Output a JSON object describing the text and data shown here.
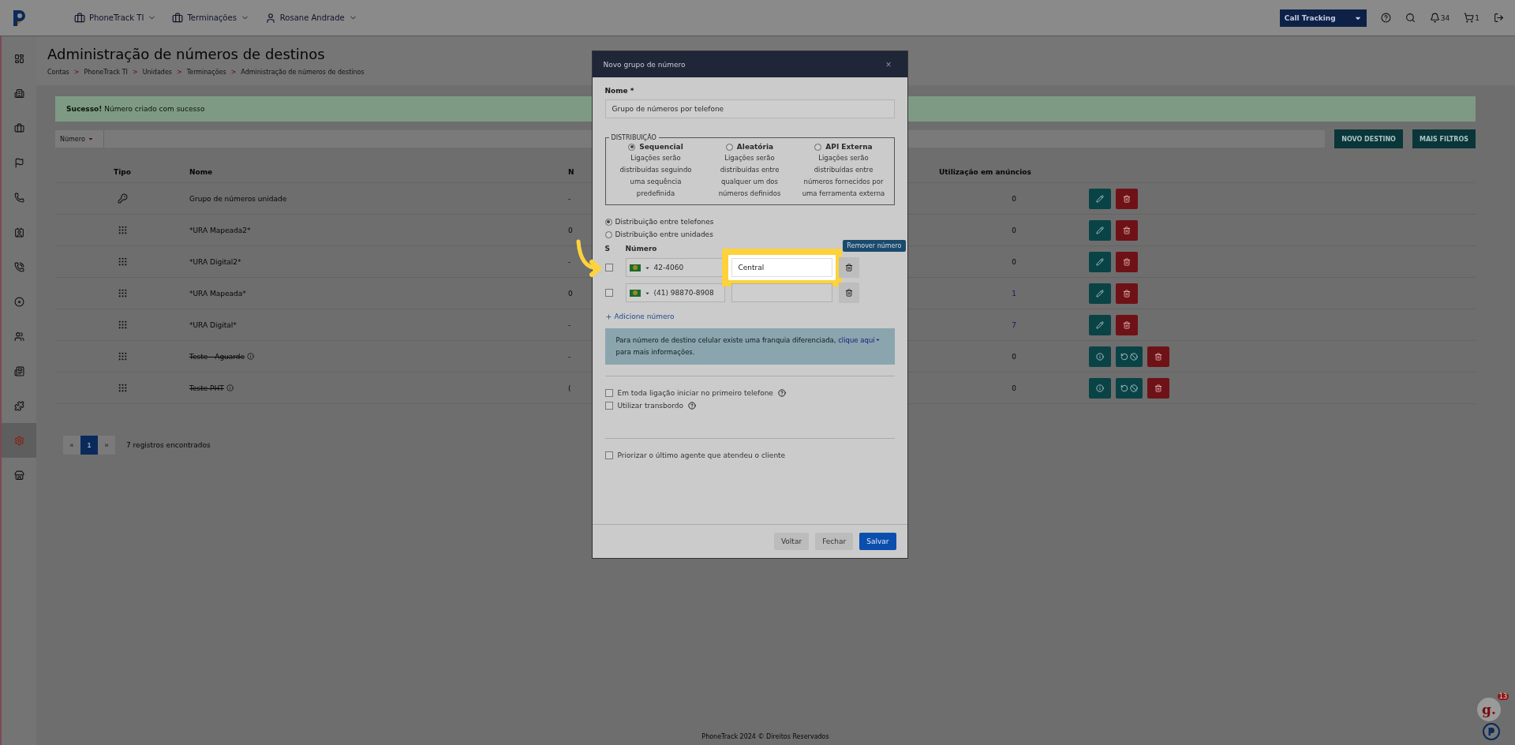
{
  "topbar": {
    "nav": [
      {
        "label": "PhoneTrack TI",
        "kind": "case"
      },
      {
        "label": "Terminações",
        "kind": "case"
      },
      {
        "label": "Rosane Andrade",
        "kind": "user"
      }
    ],
    "product_select": "Call Tracking",
    "notifications": "34",
    "cart": "1"
  },
  "sidebar": {
    "items": [
      {
        "selected": false
      },
      {
        "selected": false
      },
      {
        "selected": false
      },
      {
        "selected": false
      },
      {
        "selected": false
      },
      {
        "selected": false
      },
      {
        "selected": false
      },
      {
        "selected": false
      },
      {
        "selected": false
      },
      {
        "selected": false
      },
      {
        "selected": false
      },
      {
        "selected": true
      },
      {
        "selected": false
      }
    ]
  },
  "page": {
    "title": "Administração de números de destinos",
    "breadcrumb_separator": ">",
    "breadcrumb": [
      "Contas",
      "PhoneTrack TI",
      "Unidades",
      "Terminações",
      "Administração de números de destinos"
    ]
  },
  "alert": {
    "text": "**Sucesso!** Número criado com sucesso"
  },
  "filter": {
    "label": "Número"
  },
  "toolbar_buttons": [
    "NOVO DESTINO",
    "MAIS FILTROS"
  ],
  "table": {
    "columns": [
      "Tipo",
      "Nome",
      "N",
      "Utilização em anúncios"
    ],
    "rows": [
      {
        "kind": "group",
        "name": "Grupo de números unidade",
        "inactive": false,
        "column_3": "-",
        "usage": "0",
        "usage_linked": false
      },
      {
        "kind": "ivr",
        "name": "*URA Mapeada2*",
        "inactive": false,
        "column_3": "0",
        "usage": "0",
        "usage_linked": false
      },
      {
        "kind": "ivr",
        "name": "*URA Digital2*",
        "inactive": false,
        "column_3": "-",
        "usage": "0",
        "usage_linked": false
      },
      {
        "kind": "ivr",
        "name": "*URA Mapeada*",
        "inactive": false,
        "column_3": "0",
        "usage": "1",
        "usage_linked": true
      },
      {
        "kind": "ivr",
        "name": "*URA Digital*",
        "inactive": false,
        "column_3": "-",
        "usage": "7",
        "usage_linked": true
      },
      {
        "kind": "ivr",
        "name": "Teste - Aguarde",
        "inactive": true,
        "column_3": "-",
        "usage": "0",
        "usage_linked": false
      },
      {
        "kind": "ivr",
        "name": "Teste PHT",
        "inactive": true,
        "column_3": "(",
        "usage": "0",
        "usage_linked": false
      }
    ]
  },
  "pagination": {
    "prev": "«",
    "next": "»",
    "pages": [
      {
        "label": "1",
        "selected": true
      }
    ],
    "count": "7 registros encontrados"
  },
  "footer": "PhoneTrack 2024 © Direitos Reservados",
  "widget": {
    "logo": "g.",
    "badge": "13"
  },
  "modal": {
    "title": "Novo grupo de número",
    "close": "×",
    "name_label": "Nome *",
    "name_value": "Grupo de números por telefone",
    "distribution_legend": "DISTRIBUIÇÃO",
    "distribution": [
      {
        "label": "Sequencial",
        "description": "Ligações serão distribuídas seguindo uma sequência predefinida",
        "selected": true
      },
      {
        "label": "Aleatória",
        "description": "Ligações serão distribuídas entre qualquer um dos números definidos",
        "selected": false
      },
      {
        "label": "API Externa",
        "description": "Ligações serão distribuídas entre números fornecidos por uma ferramenta externa",
        "selected": false
      }
    ],
    "scope": [
      {
        "label": "Distribuição entre telefones",
        "selected": true
      },
      {
        "label": "Distribuição entre unidades",
        "selected": false
      }
    ],
    "number_columns": [
      "S",
      "Número"
    ],
    "numbers": [
      {
        "checked": false,
        "phone": "42-4060",
        "name": "Central",
        "highlighted": true,
        "tooltip": "Remover número"
      },
      {
        "checked": false,
        "phone": "(41) 98870-8908",
        "highlighted": false
      }
    ],
    "add_link": "Adicione número",
    "info": {
      "before": "Para número de destino celular existe uma franquia diferenciada,",
      "link": "clique aqui",
      "after": "para mais informações."
    },
    "options": [
      {
        "label": "Em toda ligação iniciar no primeiro telefone",
        "checked": false,
        "help": true
      },
      {
        "label": "Utilizar transbordo",
        "checked": false,
        "help": true
      }
    ],
    "priority": {
      "label": "Priorizar o último agente que atendeu o cliente",
      "checked": false
    },
    "buttons": [
      {
        "label": "Voltar",
        "kind": "secondary"
      },
      {
        "label": "Fechar",
        "kind": "secondary"
      },
      {
        "label": "Salvar",
        "kind": "primary"
      }
    ]
  }
}
